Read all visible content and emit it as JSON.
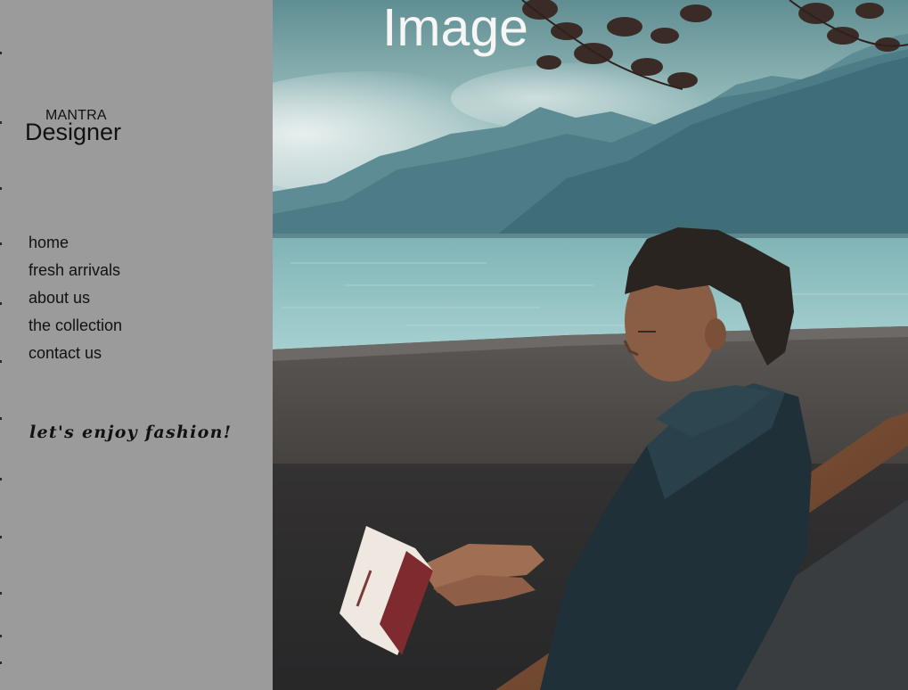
{
  "brand": {
    "small": "MANTRA",
    "large": "Designer"
  },
  "nav": {
    "items": [
      {
        "label": "home"
      },
      {
        "label": "fresh arrivals"
      },
      {
        "label": "about us"
      },
      {
        "label": "the collection"
      },
      {
        "label": "contact us"
      }
    ]
  },
  "tagline": "let's enjoy fashion!",
  "hero": {
    "title": "Image",
    "photo": "man-reading-on-bench-by-lake"
  },
  "colors": {
    "sidebar_bg": "#9b9b9b",
    "text": "#111111",
    "hero_title": "#f6f6f6"
  }
}
